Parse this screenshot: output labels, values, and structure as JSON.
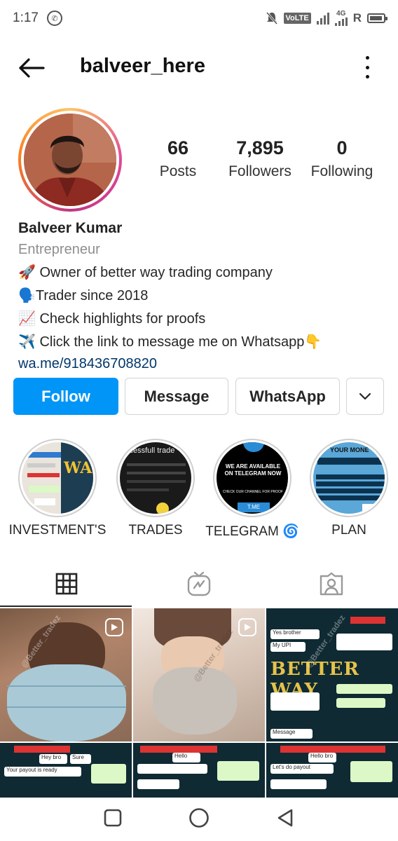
{
  "status_bar": {
    "time": "1:17",
    "volte": "VoLTE",
    "network": "4G",
    "roaming": "R"
  },
  "header": {
    "username": "balveer_here"
  },
  "stats": {
    "posts": {
      "value": "66",
      "label": "Posts"
    },
    "followers": {
      "value": "7,895",
      "label": "Followers"
    },
    "following": {
      "value": "0",
      "label": "Following"
    }
  },
  "bio": {
    "full_name": "Balveer Kumar",
    "category": "Entrepreneur",
    "lines": [
      "🚀 Owner of better way trading company",
      "🗣️Trader since 2018",
      "📈 Check highlights for proofs",
      "✈️ Click the link to message me on Whatsapp👇"
    ],
    "link": "wa.me/918436708820"
  },
  "actions": {
    "follow": "Follow",
    "message": "Message",
    "whatsapp": "WhatsApp"
  },
  "highlights": [
    {
      "label": "INVESTMENT'S",
      "cover_text": "WAY"
    },
    {
      "label": "TRADES",
      "cover_text": "ccessfull trade"
    },
    {
      "label": "TELEGRAM 🌀",
      "cover_text": "WE ARE AVAILABLE ON TELEGRAM NOW",
      "cover_sub": "CHECK OUR CHANNEL FOR PROOF",
      "cover_tag": "T.ME"
    },
    {
      "label": "PLAN",
      "cover_text": "YOUR MONE"
    }
  ],
  "grid": {
    "watermark": "@Better_tradez",
    "chat_texts": [
      "Hello bro",
      "Yes brother",
      "My UPI",
      "Message",
      "Hey bro",
      "Your payout is ready",
      "Sure",
      "Hello",
      "Let's do payout"
    ]
  },
  "colors": {
    "follow_button": "#0095f6",
    "link": "#00376b",
    "secondary_text": "#8e8e8e"
  }
}
